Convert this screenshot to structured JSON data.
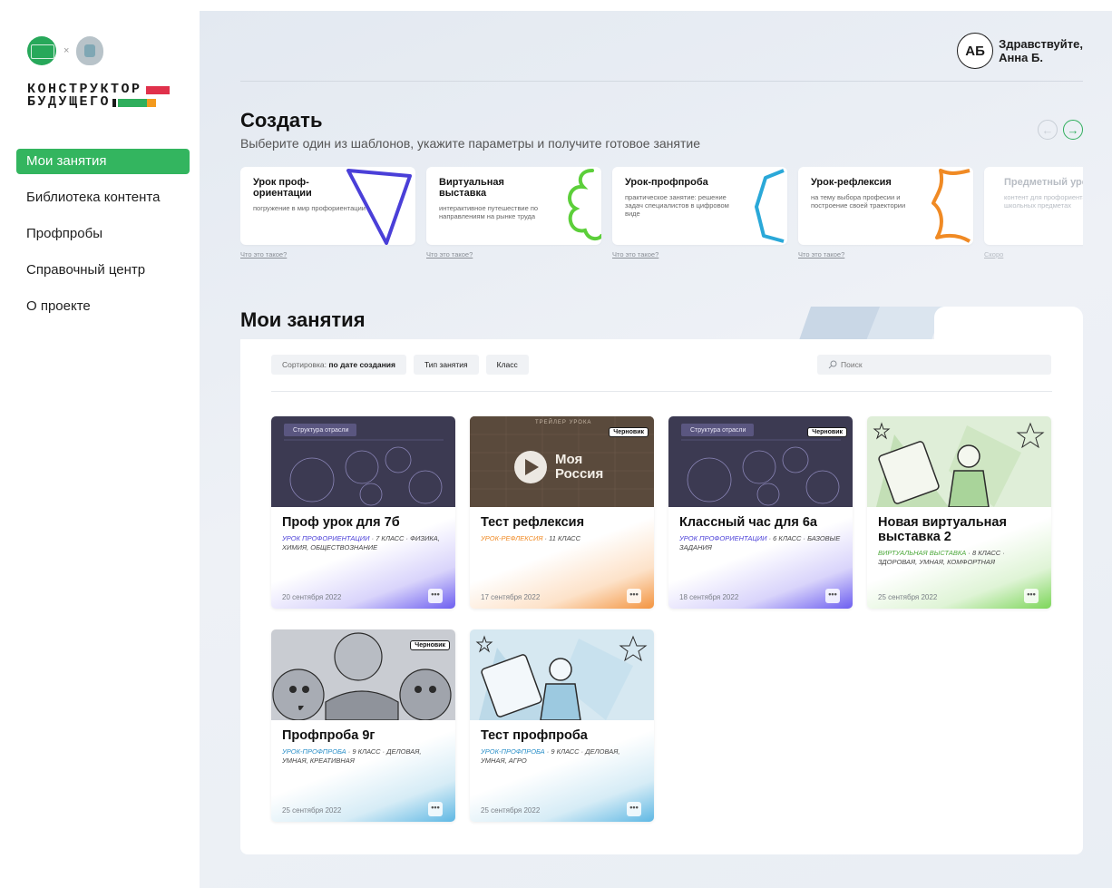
{
  "brand": {
    "line1": "КОНСТРУКТОР",
    "line2": "БУДУЩЕГО",
    "separator": "×"
  },
  "sidebar": {
    "items": [
      {
        "label": "Мои занятия",
        "active": true
      },
      {
        "label": "Библиотека контента"
      },
      {
        "label": "Профпробы"
      },
      {
        "label": "Справочный центр"
      },
      {
        "label": "О проекте"
      }
    ]
  },
  "user": {
    "initials": "АБ",
    "greeting_line1": "Здравствуйте,",
    "greeting_line2": "Анна Б."
  },
  "create": {
    "title": "Создать",
    "subtitle": "Выберите один из шаблонов, укажите параметры и получите готовое занятие",
    "templates": [
      {
        "title": "Урок проф-ориентации",
        "desc": "погружение в мир профориентации",
        "link": "Что это такое?",
        "accent": "#4a3fd8"
      },
      {
        "title": "Виртуальная выставка",
        "desc": "интерактивное путешествие по направлениям на рынке труда",
        "link": "Что это такое?",
        "accent": "#5ccf3a"
      },
      {
        "title": "Урок-профпроба",
        "desc": "практическое занятие: решение задач специалистов в цифровом виде",
        "link": "Что это такое?",
        "accent": "#2aa8d8"
      },
      {
        "title": "Урок-рефлексия",
        "desc": "на тему выбора професии и построение своей траектории",
        "link": "Что это такое?",
        "accent": "#f08a24"
      },
      {
        "title": "Предметный урок",
        "desc": "контент для профориентации на школьных предметах",
        "link": "Скоро"
      }
    ]
  },
  "my_lessons": {
    "title": "Мои занятия",
    "sort_label": "Сортировка:",
    "sort_value": "по дате создания",
    "filter_type": "Тип занятия",
    "filter_class": "Класс",
    "search_placeholder": "Поиск",
    "draft_label": "Черновик",
    "cards": [
      {
        "title": "Проф урок для 7б",
        "type": "УРОК ПРОФОРИЕНТАЦИИ",
        "type_color": "#4a3fd8",
        "details": " · 7 КЛАСС · ФИЗИКА, ХИМИЯ, ОБЩЕСТВОЗНАНИЕ",
        "date": "20 сентября 2022",
        "thumb_caption": "Структура отрасли",
        "draft": false
      },
      {
        "title": "Тест рефлексия",
        "type": "УРОК-РЕФЛЕКСИЯ",
        "type_color": "#f08a24",
        "details": " · 11 КЛАСС",
        "date": "17 сентября 2022",
        "thumb_caption": "ТРЕЙЛЕР УРОКА",
        "video_title": "Моя Россия",
        "draft": true
      },
      {
        "title": "Классный час для 6а",
        "type": "УРОК ПРОФОРИЕНТАЦИИ",
        "type_color": "#4a3fd8",
        "details": " · 6 КЛАСС · БАЗОВЫЕ ЗАДАНИЯ",
        "date": "18 сентября 2022",
        "thumb_caption": "Структура отрасли",
        "draft": true
      },
      {
        "title": "Новая виртуальная выставка 2",
        "type": "ВИРТУАЛЬНАЯ ВЫСТАВКА",
        "type_color": "#4ca83a",
        "details": " · 8 КЛАСС · ЗДОРОВАЯ, УМНАЯ, КОМФОРТНАЯ",
        "date": "25 сентября 2022",
        "draft": false
      },
      {
        "title": "Профпроба 9г",
        "type": "УРОК-ПРОФПРОБА",
        "type_color": "#2a8fc8",
        "details": " · 9 КЛАСС · ДЕЛОВАЯ, УМНАЯ, КРЕАТИВНАЯ",
        "date": "25 сентября 2022",
        "draft": true
      },
      {
        "title": "Тест профпроба",
        "type": "УРОК-ПРОФПРОБА",
        "type_color": "#2a8fc8",
        "details": " · 9 КЛАСС · ДЕЛОВАЯ, УМНАЯ, АГРО",
        "date": "25 сентября 2022",
        "draft": false
      }
    ],
    "more_label": "•••"
  },
  "colors": {
    "accent_green": "#33b55f",
    "brand_red": "#e0314b",
    "brand_green": "#2fae5c",
    "brand_orange": "#f39a1e"
  },
  "icons": [
    "arrow-left-icon",
    "arrow-right-icon",
    "search-icon",
    "more-icon",
    "play-icon"
  ]
}
